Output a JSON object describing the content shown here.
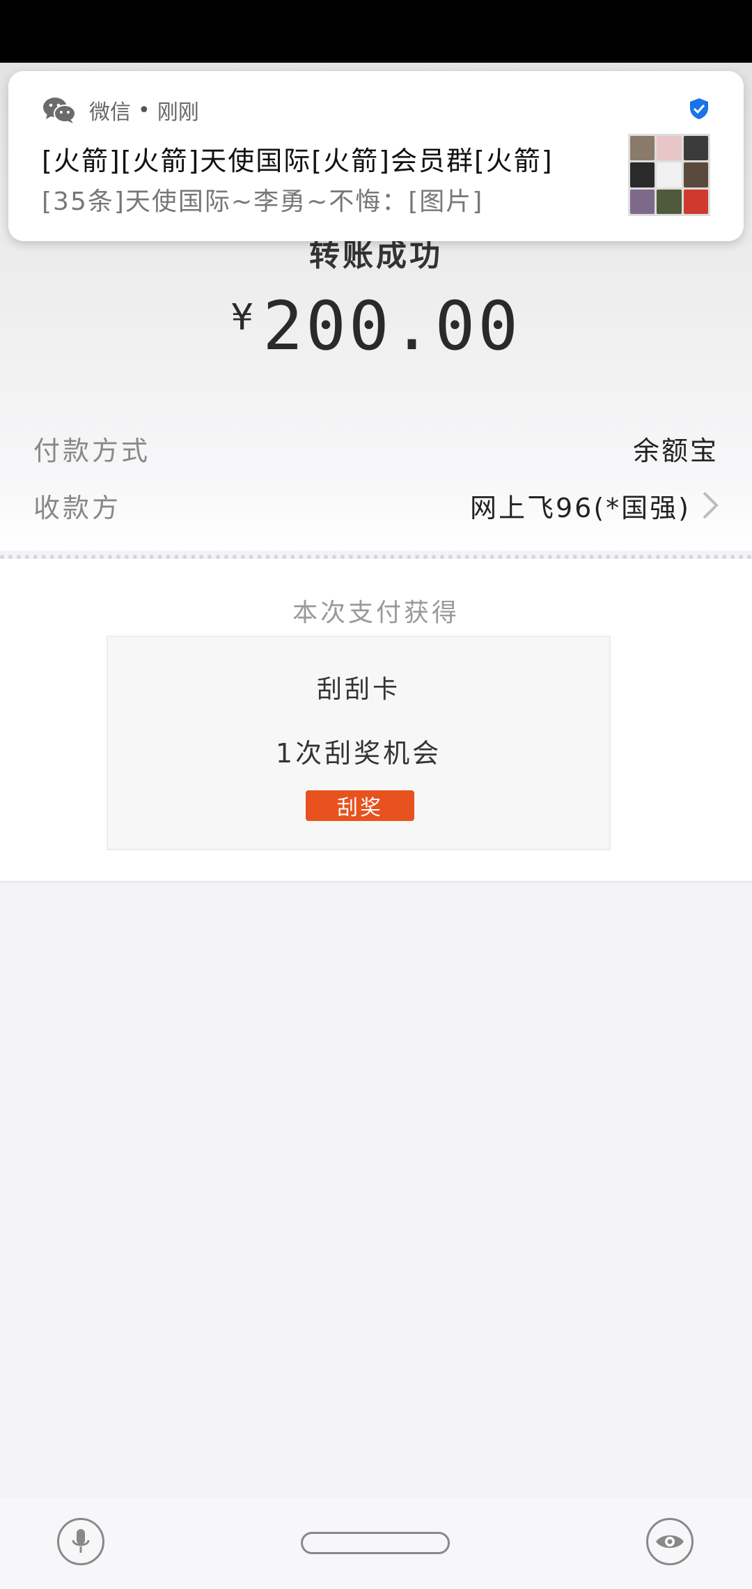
{
  "notification": {
    "app_name": "微信",
    "separator": "•",
    "time": "刚刚",
    "title": "[火箭][火箭]天使国际[火箭]会员群[火箭]",
    "body": "[35条]天使国际~李勇~不悔：[图片]",
    "icons": [
      "wechat-icon",
      "verified-shield-icon",
      "group-avatar"
    ]
  },
  "payment": {
    "status": "转账成功",
    "currency_symbol": "¥",
    "amount": "200.00",
    "method_label": "付款方式",
    "method_value": "余额宝",
    "payee_label": "收款方",
    "payee_value": "网上飞96(*国强)"
  },
  "reward": {
    "heading": "本次支付获得",
    "card_name": "刮刮卡",
    "card_desc": "1次刮奖机会",
    "button_label": "刮奖"
  },
  "nav": {
    "icons": [
      "microphone-icon",
      "home-pill",
      "eye-icon"
    ]
  },
  "colors": {
    "accent": "#e8521f",
    "verified": "#1a73e8",
    "wechat_gray": "#6b6b6b"
  }
}
